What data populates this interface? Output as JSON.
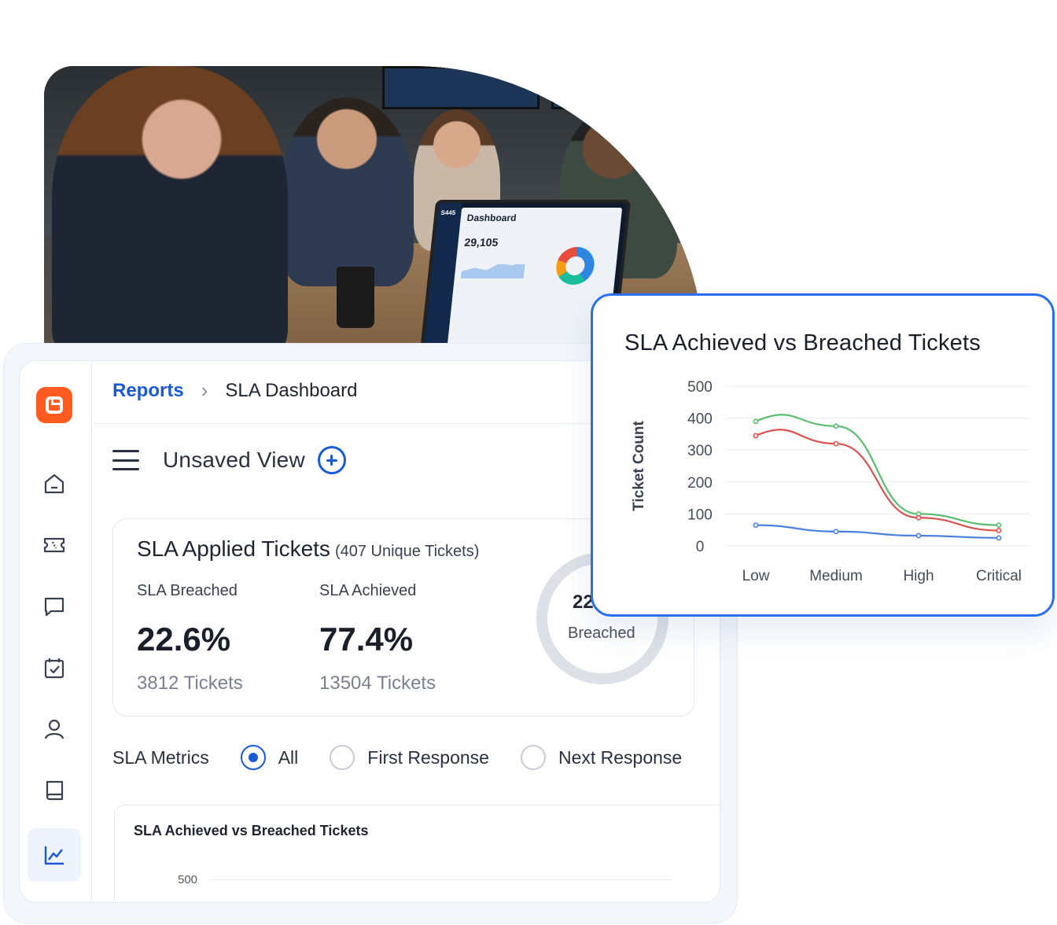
{
  "breadcrumb": {
    "parent": "Reports",
    "separator": "›",
    "current": "SLA Dashboard"
  },
  "view": {
    "title": "Unsaved View"
  },
  "photo": {
    "laptop_brand": "S445",
    "laptop_title": "Dashboard",
    "laptop_number": "29,105"
  },
  "sla_card": {
    "title": "SLA Applied Tickets",
    "subtitle": "(407 Unique Tickets)",
    "breached": {
      "label": "SLA Breached",
      "value": "22.6%",
      "tickets": "3812 Tickets"
    },
    "achieved": {
      "label": "SLA Achieved",
      "value": "77.4%",
      "tickets": "13504 Tickets"
    },
    "ring": {
      "value": "22",
      "label": "Breached"
    }
  },
  "metrics": {
    "label": "SLA Metrics",
    "options": [
      "All",
      "First Response",
      "Next Response"
    ],
    "selected": "All"
  },
  "mini_chart": {
    "title": "SLA Achieved vs Breached Tickets",
    "tick": "500"
  },
  "chart_data": {
    "type": "line",
    "title": "SLA Achieved vs Breached Tickets",
    "xlabel": "",
    "ylabel": "Ticket Count",
    "categories": [
      "Low",
      "Medium",
      "High",
      "Critical"
    ],
    "ylim": [
      0,
      500
    ],
    "yticks": [
      "500",
      "400",
      "300",
      "200",
      "100",
      "0"
    ],
    "series": [
      {
        "values": [
          390,
          375,
          100,
          65
        ],
        "color": "#5bbd6f"
      },
      {
        "values": [
          345,
          320,
          88,
          48
        ],
        "color": "#d9534f"
      },
      {
        "values": [
          65,
          45,
          32,
          25
        ],
        "color": "#4a7fe0"
      }
    ],
    "grid": true,
    "legend": "none"
  },
  "sidebar": {
    "items": [
      "home-icon",
      "ticket-icon",
      "chat-icon",
      "calendar-check-icon",
      "user-icon",
      "book-icon",
      "chart-icon"
    ],
    "active": "chart-icon"
  },
  "colors": {
    "accent": "#1a5ad7",
    "brand": "#ff5a1f",
    "card_border": "#2a6ff0"
  }
}
